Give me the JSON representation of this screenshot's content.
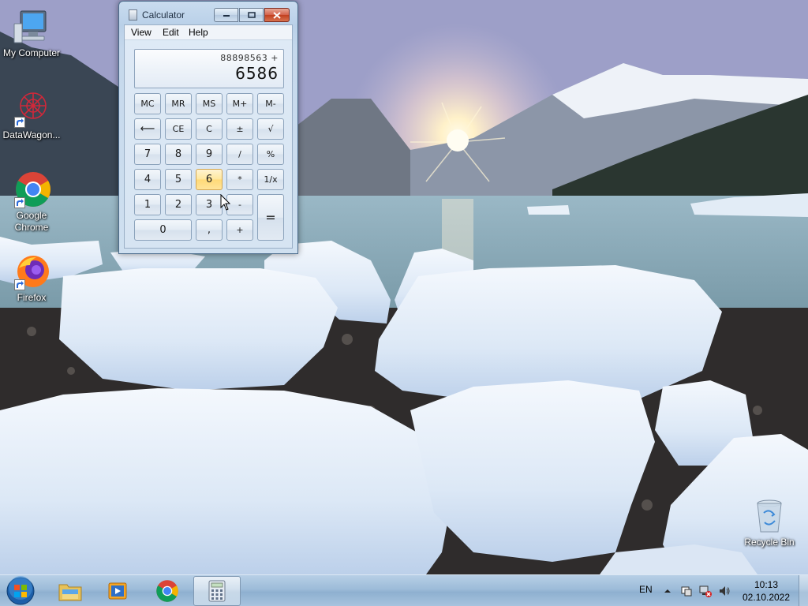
{
  "desktop": {
    "icons": [
      {
        "label": "My Computer",
        "icon": "computer-icon"
      },
      {
        "label": "DataWagon...",
        "icon": "datawagon-icon"
      },
      {
        "label": "Google Chrome",
        "label_line1": "Google",
        "label_line2": "Chrome",
        "icon": "chrome-icon"
      },
      {
        "label": "Firefox",
        "icon": "firefox-icon"
      },
      {
        "label": "Recycle Bin",
        "icon": "recycle-bin-icon"
      }
    ]
  },
  "calculator": {
    "title": "Calculator",
    "menu": [
      "View",
      "Edit",
      "Help"
    ],
    "display": {
      "history": "88898563 +",
      "value": "6586"
    },
    "buttons": {
      "mc": "MC",
      "mr": "MR",
      "ms": "MS",
      "mplus": "M+",
      "mminus": "M-",
      "back": "⟵",
      "ce": "CE",
      "c": "C",
      "plusminus": "±",
      "sqrt": "√",
      "n7": "7",
      "n8": "8",
      "n9": "9",
      "div": "/",
      "pct": "%",
      "n4": "4",
      "n5": "5",
      "n6": "6",
      "mul": "*",
      "recip": "1/x",
      "n1": "1",
      "n2": "2",
      "n3": "3",
      "sub": "-",
      "eq": "=",
      "n0": "0",
      "dot": ",",
      "add": "+"
    },
    "hovered_button": "6"
  },
  "taskbar": {
    "items": [
      "start-orb",
      "file-explorer",
      "media-player",
      "google-chrome",
      "calculator"
    ],
    "active_item": "calculator",
    "language": "EN",
    "clock": {
      "time": "10:13",
      "date": "02.10.2022"
    }
  },
  "colors": {
    "taskbar": "#9dbcd9",
    "window_frame": "#b9d0e8",
    "hot_button": "#ffe79c",
    "close_button": "#c2401f"
  }
}
